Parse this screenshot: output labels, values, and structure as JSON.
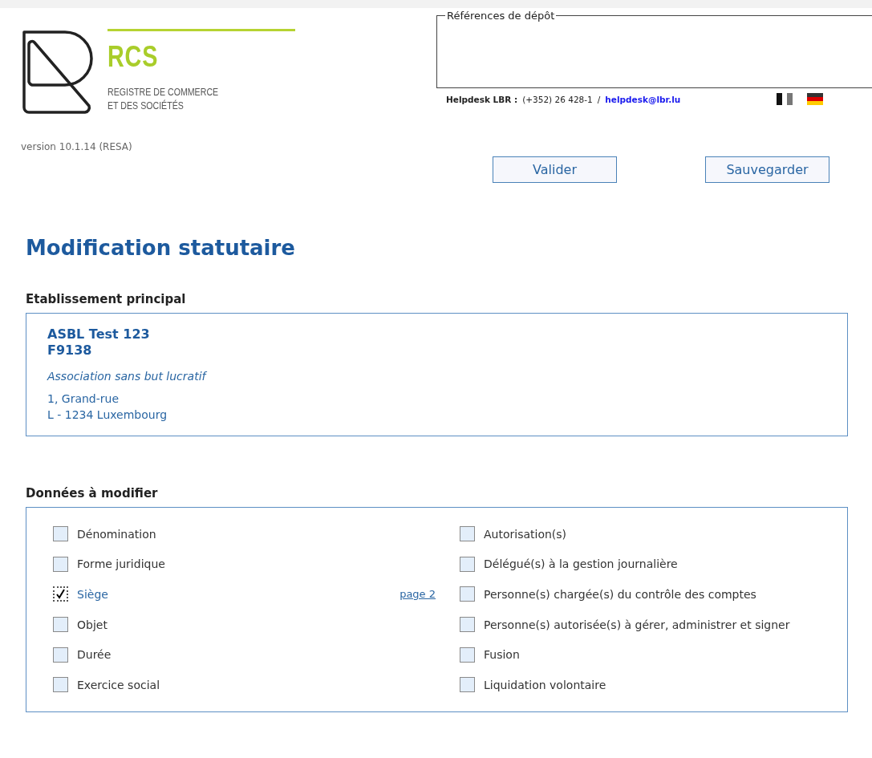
{
  "logo": {
    "acronym": "RCS",
    "subtitle_lines": [
      "REGISTRE DE COMMERCE",
      "ET DES SOCIÉTÉS"
    ]
  },
  "version": "version 10.1.14 (RESA)",
  "deposit_references": {
    "legend": "Références de dépôt"
  },
  "helpdesk": {
    "label": "Helpdesk LBR :",
    "phone": "(+352) 26 428-1",
    "separator": "/",
    "email": "helpdesk@lbr.lu"
  },
  "buttons": [
    "Valider",
    "Sauvegarder"
  ],
  "title": "Modification statutaire",
  "establishment": {
    "heading": "Etablissement principal",
    "name": "ASBL Test 123",
    "number": "F9138",
    "legal_form": "Association sans but lucratif",
    "address_lines": [
      "1, Grand-rue",
      "L - 1234 Luxembourg"
    ]
  },
  "data_to_modify": {
    "heading": "Données à modifier",
    "columns": [
      [
        {
          "label": "Dénomination",
          "checked": false
        },
        {
          "label": "Forme juridique",
          "checked": false
        },
        {
          "label": "Siège",
          "checked": true,
          "link": "page 2"
        },
        {
          "label": "Objet",
          "checked": false
        },
        {
          "label": "Durée",
          "checked": false
        },
        {
          "label": "Exercice social",
          "checked": false
        }
      ],
      [
        {
          "label": "Autorisation(s)",
          "checked": false
        },
        {
          "label": "Délégué(s) à la gestion journalière",
          "checked": false
        },
        {
          "label": "Personne(s) chargée(s) du contrôle des comptes",
          "checked": false
        },
        {
          "label": "Personne(s) autorisée(s) à gérer, administrer et signer",
          "checked": false
        },
        {
          "label": "Fusion",
          "checked": false
        },
        {
          "label": "Liquidation volontaire",
          "checked": false
        }
      ]
    ]
  }
}
